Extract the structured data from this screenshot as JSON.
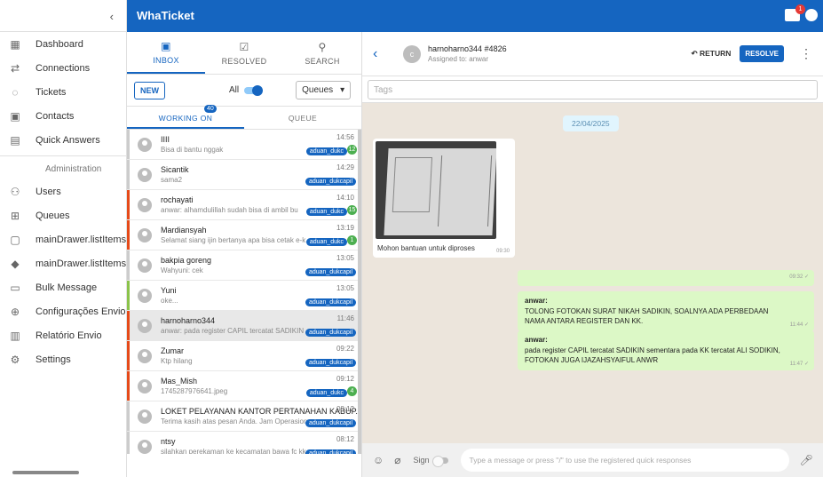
{
  "app": {
    "brand": "WhaTicket",
    "notif_badge": "1"
  },
  "sidebar": {
    "collapse_icon": "‹",
    "items": [
      {
        "icon": "dashboard-icon",
        "glyph": "▦",
        "label": "Dashboard"
      },
      {
        "icon": "connections-icon",
        "glyph": "⇄",
        "label": "Connections"
      },
      {
        "icon": "whatsapp-icon",
        "glyph": "◌",
        "label": "Tickets"
      },
      {
        "icon": "contacts-icon",
        "glyph": "▣",
        "label": "Contacts"
      },
      {
        "icon": "quick-answers-icon",
        "glyph": "▤",
        "label": "Quick Answers"
      }
    ],
    "admin_label": "Administration",
    "admin_items": [
      {
        "icon": "users-icon",
        "glyph": "⚇",
        "label": "Users"
      },
      {
        "icon": "queues-icon",
        "glyph": "⊞",
        "label": "Queues"
      },
      {
        "icon": "calendar-icon",
        "glyph": "▢",
        "label": "mainDrawer.listItems.s"
      },
      {
        "icon": "tag-icon",
        "glyph": "◆",
        "label": "mainDrawer.listItems.t"
      },
      {
        "icon": "chat-icon",
        "glyph": "▭",
        "label": "Bulk Message"
      },
      {
        "icon": "add-circle-icon",
        "glyph": "⊕",
        "label": "Configurações Envio"
      },
      {
        "icon": "report-icon",
        "glyph": "▥",
        "label": "Relatório Envio"
      },
      {
        "icon": "settings-icon",
        "glyph": "⚙",
        "label": "Settings"
      }
    ]
  },
  "tickets": {
    "tabs": [
      {
        "icon": "inbox-icon",
        "glyph": "▣",
        "label": "INBOX"
      },
      {
        "icon": "resolved-icon",
        "glyph": "☑",
        "label": "RESOLVED"
      },
      {
        "icon": "search-icon",
        "glyph": "⚲",
        "label": "SEARCH"
      }
    ],
    "new_label": "NEW",
    "all_label": "All",
    "queues_label": "Queues",
    "subtabs": {
      "working": "WORKING ON",
      "working_count": "40",
      "queue": "QUEUE"
    },
    "rows": [
      {
        "name": "IIII",
        "msg": "Bisa di bantu nggak",
        "time": "14:56",
        "queue": "aduan_dukc",
        "unread": "12",
        "color": "#cccccc",
        "selected": false
      },
      {
        "name": "Sicantik",
        "msg": "sama2",
        "time": "14:29",
        "queue": "aduan_dukcapil",
        "unread": "",
        "color": "#cccccc",
        "selected": false
      },
      {
        "name": "rochayati",
        "msg": "anwar: alhamdulillah sudah bisa di ambil bu",
        "time": "14:10",
        "queue": "aduan_dukc",
        "unread": "15",
        "color": "#e64a19",
        "selected": false
      },
      {
        "name": "Mardiansyah",
        "msg": "Selamat siang ijin bertanya apa bisa cetak e-k",
        "time": "13:19",
        "queue": "aduan_dukc",
        "unread": "1",
        "color": "#e64a19",
        "selected": false
      },
      {
        "name": "bakpia goreng",
        "msg": "Wahyuni: cek",
        "time": "13:05",
        "queue": "aduan_dukcapil",
        "unread": "",
        "color": "#cccccc",
        "selected": false
      },
      {
        "name": "Yuni",
        "msg": "oke...",
        "time": "13:05",
        "queue": "aduan_dukcapil",
        "unread": "",
        "color": "#8bc34a",
        "selected": false
      },
      {
        "name": "harnoharno344",
        "msg": "anwar: pada register CAPIL tercatat SADIKIN",
        "time": "11:46",
        "queue": "aduan_dukcapil",
        "unread": "",
        "color": "#e64a19",
        "selected": true
      },
      {
        "name": "Zumar",
        "msg": "Ktp hilang",
        "time": "09:22",
        "queue": "aduan_dukcapil",
        "unread": "",
        "color": "#e64a19",
        "selected": false
      },
      {
        "name": "Mas_Mish",
        "msg": "1745287976641.jpeg",
        "time": "09:12",
        "queue": "aduan_dukc",
        "unread": "4",
        "color": "#e64a19",
        "selected": false
      },
      {
        "name": "LOKET PELAYANAN KANTOR PERTANAHAN KABUP...",
        "msg": "Terima kasih atas pesan Anda. Jam Operasion",
        "time": "08:12",
        "queue": "aduan_dukcapil",
        "unread": "",
        "color": "#cccccc",
        "selected": false
      },
      {
        "name": "ntsy",
        "msg": "silahkan perekaman ke kecamatan bawa fc kk",
        "time": "08:12",
        "queue": "aduan_dukcapil",
        "unread": "",
        "color": "#cccccc",
        "selected": false
      }
    ]
  },
  "chat": {
    "contact_name": "harnoharno344 #4826",
    "assigned": "Assigned to: anwar",
    "avatar_letter": "c",
    "return_label": "RETURN",
    "resolve_label": "RESOLVE",
    "tags_placeholder": "Tags",
    "date_label": "22/04/2025",
    "image_caption": "Mohon bantuan untuk diproses",
    "image_time": "09:30",
    "empty_out_time": "09:32",
    "outgoing": [
      {
        "author": "anwar:",
        "text": "TOLONG FOTOKAN SURAT NIKAH SADIKIN, SOALNYA ADA PERBEDAAN NAMA ANTARA REGISTER DAN KK.",
        "time": "11:44"
      },
      {
        "author": "anwar:",
        "text": "pada register CAPIL tercatat SADIKIN sementara pada KK tercatat ALI SODIKIN, FOTOKAN JUGA IJAZAHSYAIFUL ANWR",
        "time": "11:47"
      }
    ],
    "sign_label": "Sign",
    "composer_placeholder": "Type a message or press \"/\" to use the registered quick responses"
  }
}
